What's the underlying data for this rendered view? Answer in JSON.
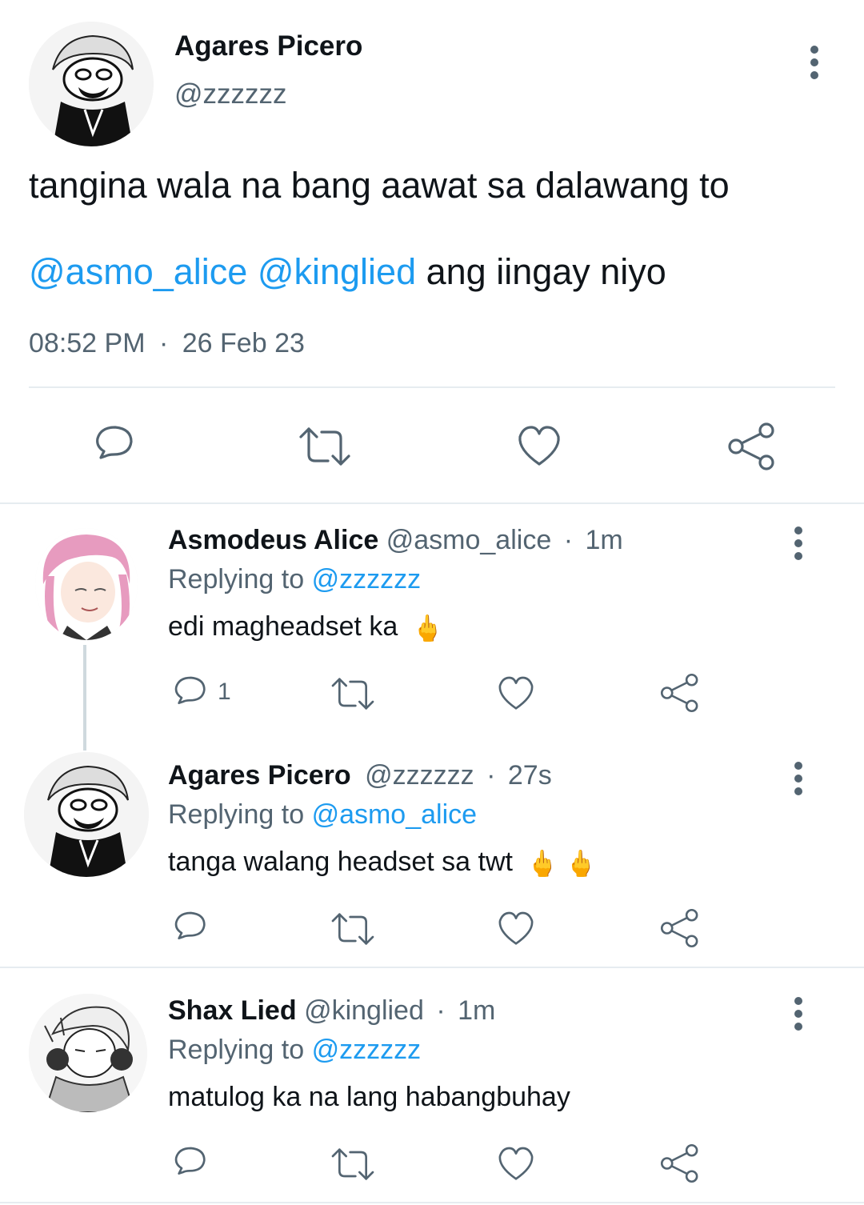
{
  "main_tweet": {
    "author_name": "Agares Picero",
    "author_handle": "@zzzzzz",
    "text_line1": "tangina wala na bang aawat sa dalawang to",
    "mention1": "@asmo_alice",
    "mention2": "@kinglied",
    "text_line2_rest": "ang iingay niyo",
    "time": "08:52 PM",
    "sep": "·",
    "date": "26 Feb 23",
    "actions": [
      "reply-icon",
      "retweet-icon",
      "like-icon",
      "share-icon"
    ]
  },
  "replies": [
    {
      "name": "Asmodeus Alice",
      "handle": "@asmo_alice",
      "sep": "·",
      "time": "1m",
      "replying_prefix": "Replying to",
      "replying_to": "@zzzzzz",
      "text": "edi magheadset ka",
      "emojis": "🖕",
      "reply_count": "1"
    },
    {
      "name": "Agares Picero",
      "handle": "@zzzzzz",
      "sep": "·",
      "time": "27s",
      "replying_prefix": "Replying to",
      "replying_to": "@asmo_alice",
      "text": "tanga walang headset sa twt",
      "emojis": "🖕🖕",
      "reply_count": ""
    },
    {
      "name": "Shax Lied",
      "handle": "@kinglied",
      "sep": "·",
      "time": "1m",
      "replying_prefix": "Replying to",
      "replying_to": "@zzzzzz",
      "text": "matulog ka na lang habangbuhay",
      "emojis": "",
      "reply_count": ""
    }
  ],
  "colors": {
    "link": "#1d9bf0",
    "muted": "#536471",
    "text": "#0f1419",
    "divider": "#e6ecf0",
    "emoji": "#f6b91c"
  }
}
